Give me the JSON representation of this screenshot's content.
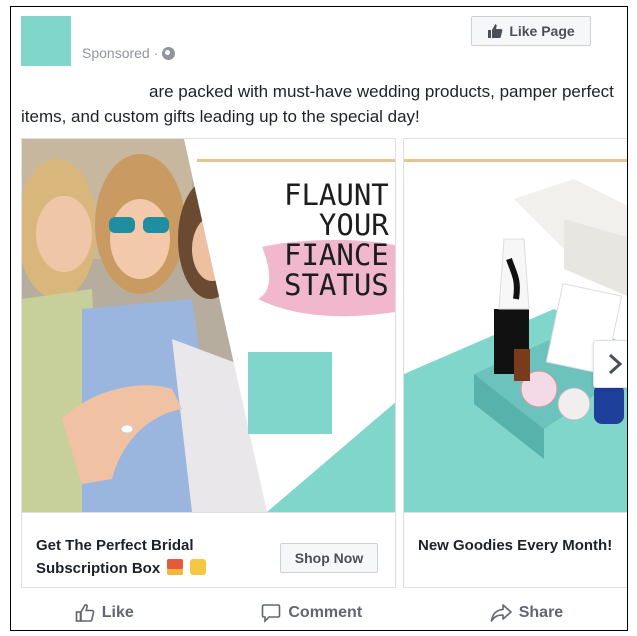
{
  "post": {
    "sponsored": "Sponsored · ",
    "like_page": "Like Page",
    "text": "are packed with must-have wedding products, pamper perfect items, and custom gifts leading up to the special day!"
  },
  "cards": [
    {
      "image_lines": [
        "FLAUNT",
        "YOUR",
        "FIANCE",
        "STATUS"
      ],
      "title_line1": "Get The Perfect Bridal",
      "title_line2": "Subscription Box",
      "cta": "Shop Now"
    },
    {
      "title": "New Goodies Every Month!"
    }
  ],
  "actions": {
    "like": "Like",
    "comment": "Comment",
    "share": "Share"
  },
  "colors": {
    "teal": "#80d6cb",
    "pink": "#f0b7cd",
    "gold_rule": "#e3c68f",
    "text": "#1d2129",
    "muted": "#90949c"
  },
  "icons": {
    "privacy": "globe-icon",
    "like_page": "thumbs-up-icon",
    "like": "thumbs-up-outline-icon",
    "comment": "comment-icon",
    "share": "share-arrow-icon",
    "next": "chevron-right-icon",
    "gift": "gift-emoji",
    "ring": "ring-emoji"
  }
}
